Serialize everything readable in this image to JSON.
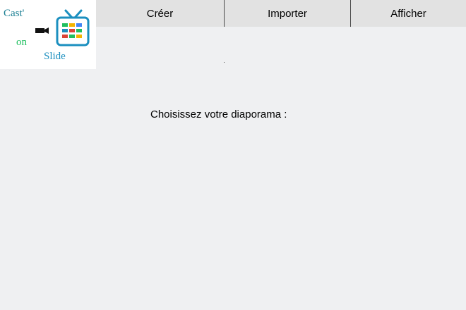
{
  "logo": {
    "word_cast": "Cast'",
    "word_on": "on",
    "word_slide": "Slide",
    "camera_icon": "video-camera-icon",
    "tv_icon": "tv-icon",
    "colors": {
      "cast": "#1b7f93",
      "on": "#1fbf5f",
      "slide": "#1b8fbf"
    }
  },
  "menu": {
    "items": [
      {
        "label": "Créer"
      },
      {
        "label": "Importer"
      },
      {
        "label": "Afficher"
      }
    ]
  },
  "main": {
    "prompt": "Choisissez votre diaporama :"
  },
  "colors": {
    "background": "#eff0f2",
    "menubar": "#e2e2e2",
    "separator": "#4a4a4a"
  }
}
